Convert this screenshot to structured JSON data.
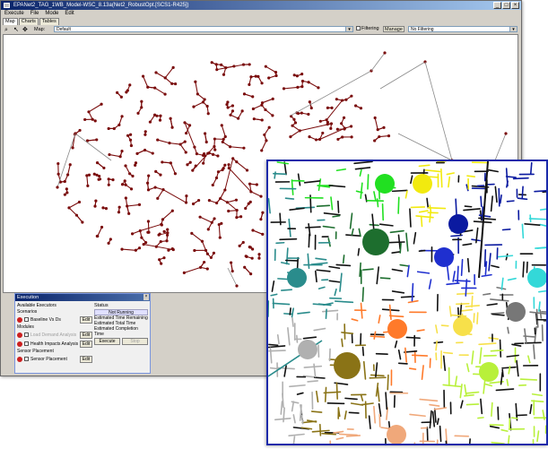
{
  "window": {
    "title": "EPANet2_TAG_1WB_Model-WSC_8.13a(Net2_RobustOpt.[SCS1-R425])"
  },
  "menu": [
    "Execute",
    "File",
    "Mode",
    "Edit"
  ],
  "tabs": [
    "Map",
    "Charts",
    "Tables"
  ],
  "toolbar": {
    "map_label": "Map:",
    "map_value": "Default",
    "filtering_label": "Filtering",
    "manage_label": "Manage",
    "filter_value": "No Filtering"
  },
  "execution": {
    "title": "Execution",
    "available_label": "Available Executors",
    "sections": [
      {
        "name": "Scenarios",
        "items": [
          {
            "label": "Baseline Vs Ds",
            "enabled": true,
            "edit": "Edit"
          }
        ]
      },
      {
        "name": "Modules",
        "items": [
          {
            "label": "Load Demand Analysis",
            "enabled": false,
            "edit": "Edit"
          },
          {
            "label": "Health Impacts Analysis",
            "enabled": true,
            "edit": "Edit"
          }
        ]
      },
      {
        "name": "Sensor Placement",
        "items": [
          {
            "label": "Sensor Placement",
            "enabled": true,
            "edit": "Edit"
          }
        ]
      }
    ],
    "status": {
      "title": "Status",
      "state": "Not Running",
      "lines": [
        "Estimated Time Remaining",
        "Estimated Total Time",
        "Estimated Completion Time"
      ],
      "execute": "Execute",
      "stop": "Stop"
    }
  },
  "colors": {
    "network": "#7a0c0c",
    "inset_border": "#1a2aaa",
    "zones": [
      "#21e021",
      "#f2ea0f",
      "#0b1aa0",
      "#1f2fcf",
      "#2a8c8c",
      "#1d6e2e",
      "#33d8d8",
      "#ff7a2a",
      "#f7e04a",
      "#777777",
      "#b0b0b0",
      "#8a7316",
      "#b8f03a",
      "#f0a87a"
    ]
  }
}
